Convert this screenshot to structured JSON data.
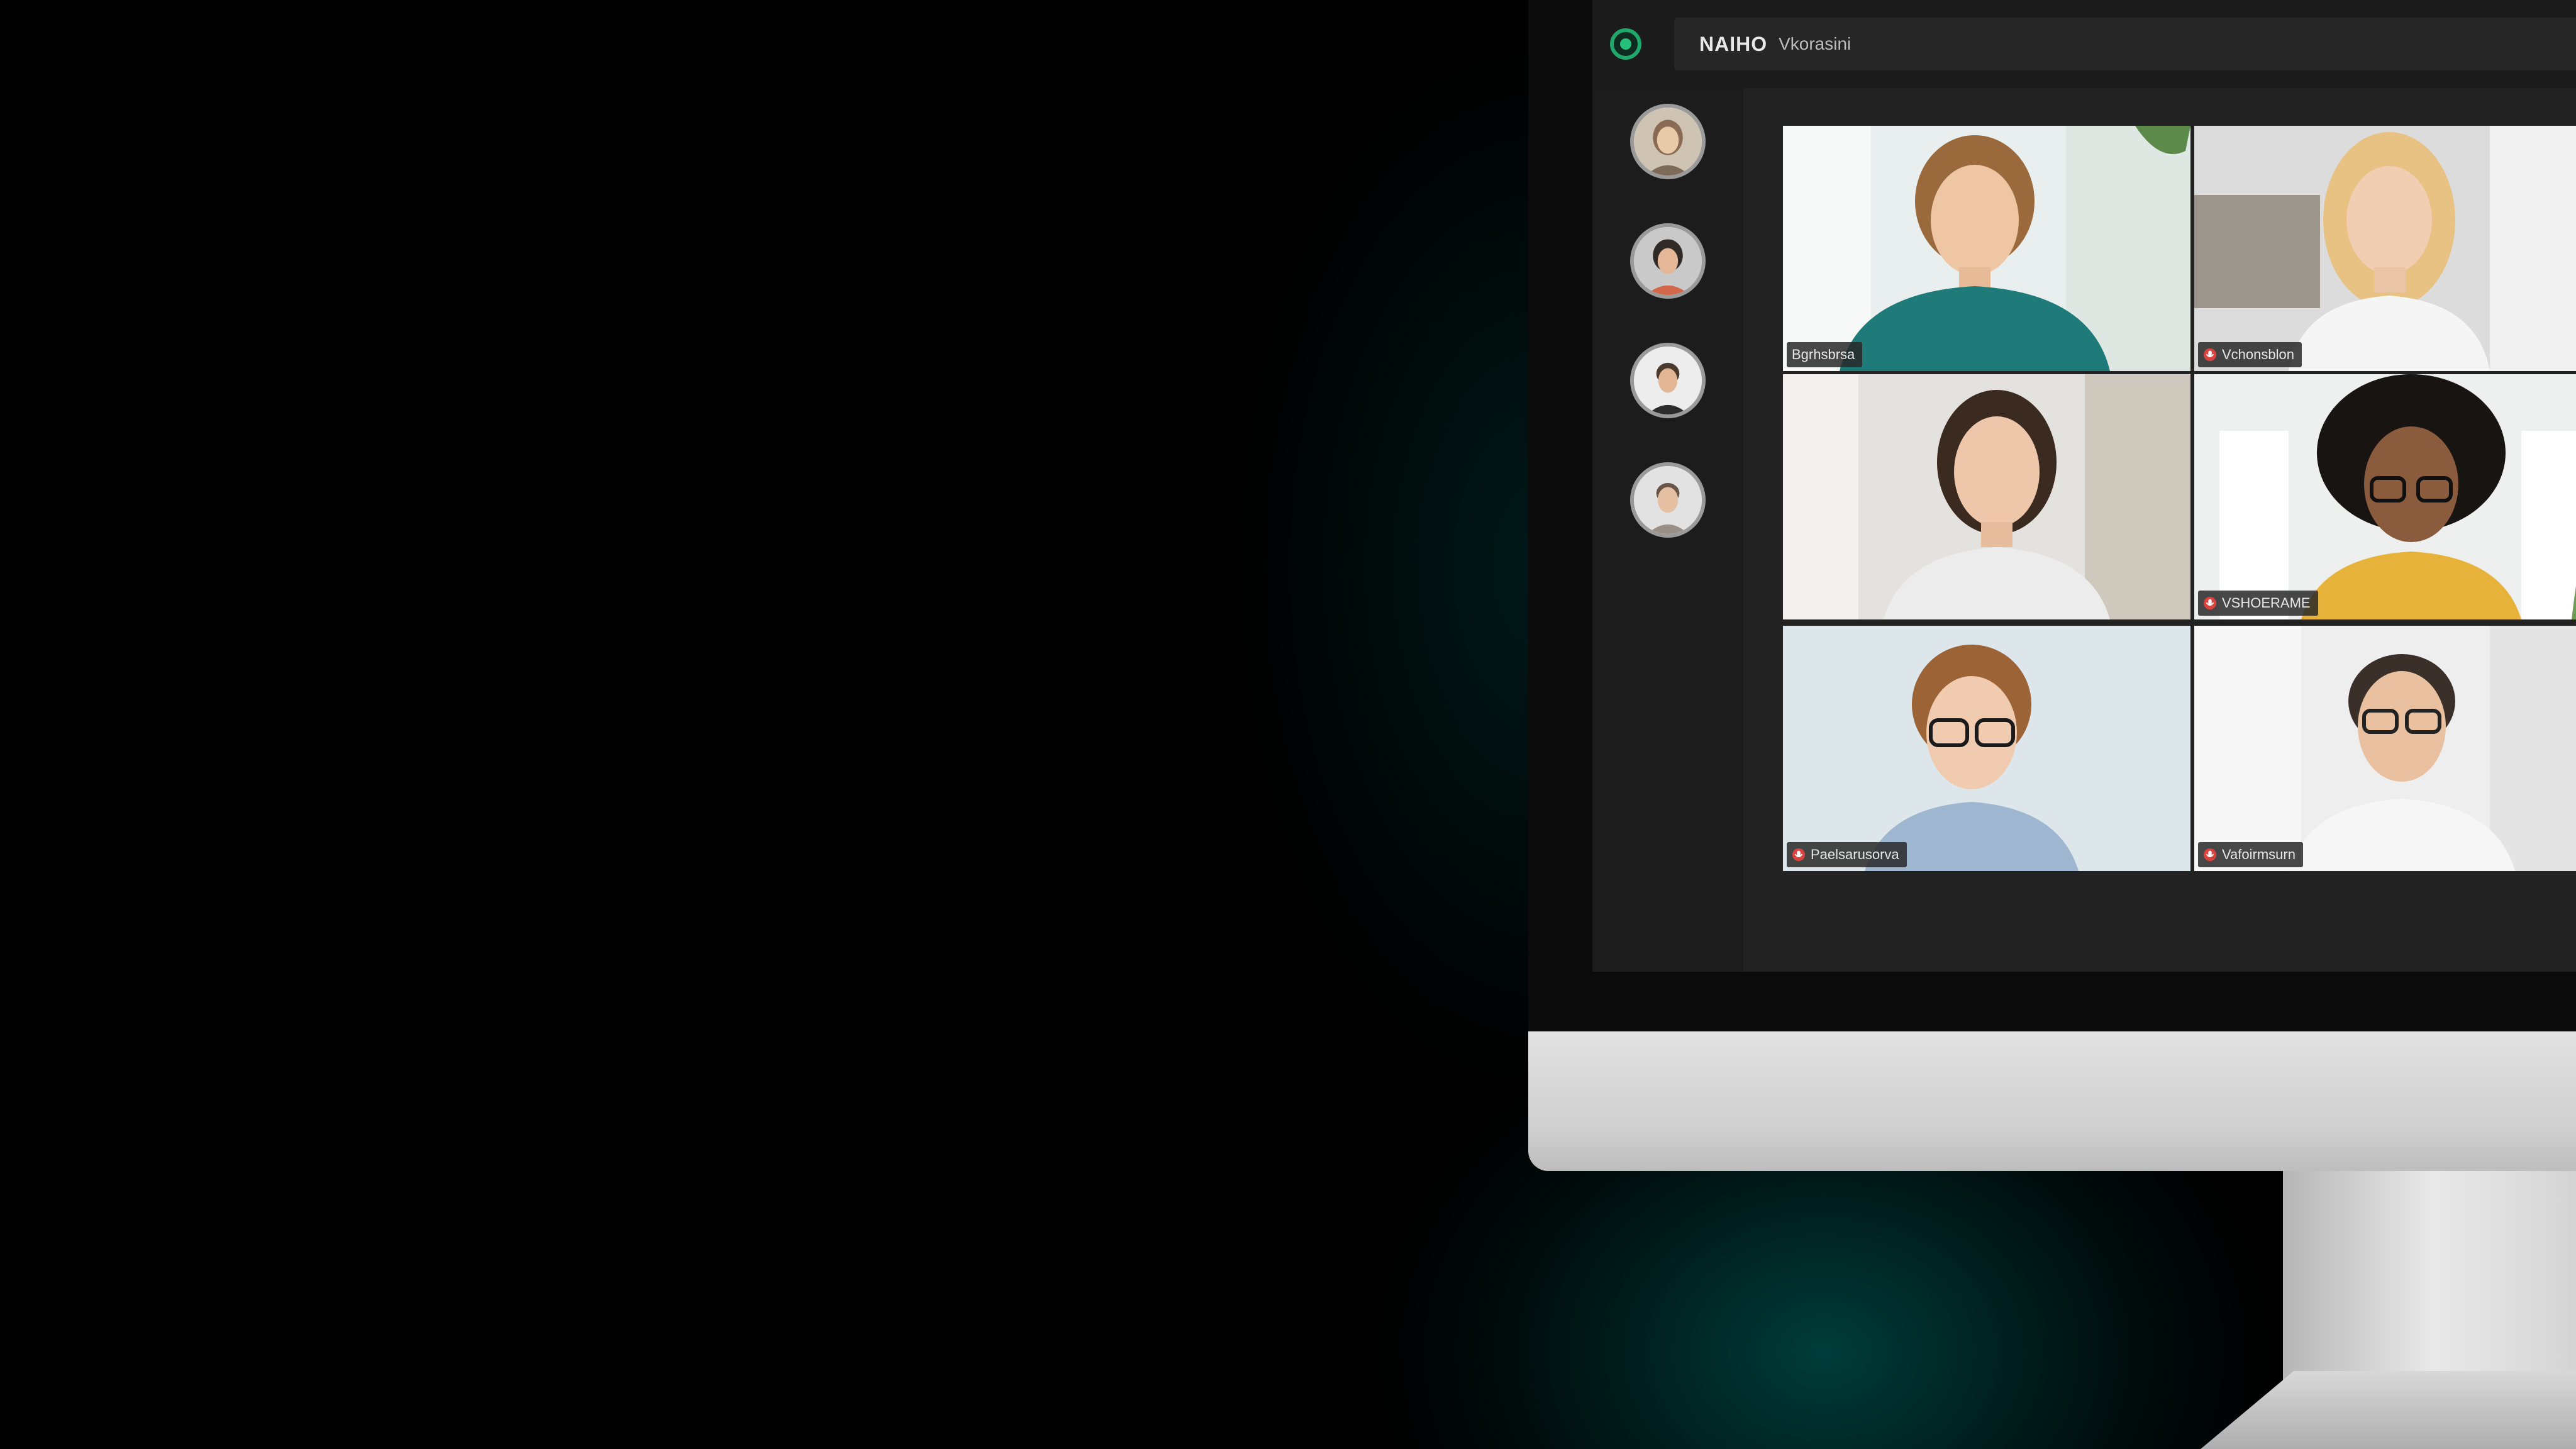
{
  "app": {
    "title": "NAIHO",
    "subtitle": "Vkorasini"
  },
  "colors": {
    "accent": "#21a66b",
    "active_speaker": "#d7cf6b",
    "mic_muted": "#d8433f"
  },
  "sidebar": {
    "participants": [
      {
        "icon": "avatar-1"
      },
      {
        "icon": "avatar-2"
      },
      {
        "icon": "avatar-3"
      },
      {
        "icon": "avatar-4"
      }
    ]
  },
  "grid": {
    "tiles": [
      {
        "name": "Bgrhsbrsa",
        "active": true,
        "mic_icon": "none"
      },
      {
        "name": "Vchonsblon",
        "active": false,
        "mic_icon": "mic-off-icon"
      },
      {
        "name": "",
        "active": false,
        "mic_icon": "none"
      },
      {
        "name": "VSHOERAME",
        "active": false,
        "mic_icon": "mic-off-icon"
      },
      {
        "name": "Paelsarusorva",
        "active": false,
        "mic_icon": "mic-off-icon"
      },
      {
        "name": "Vafoirmsurn",
        "active": false,
        "mic_icon": "mic-off-icon"
      }
    ]
  }
}
